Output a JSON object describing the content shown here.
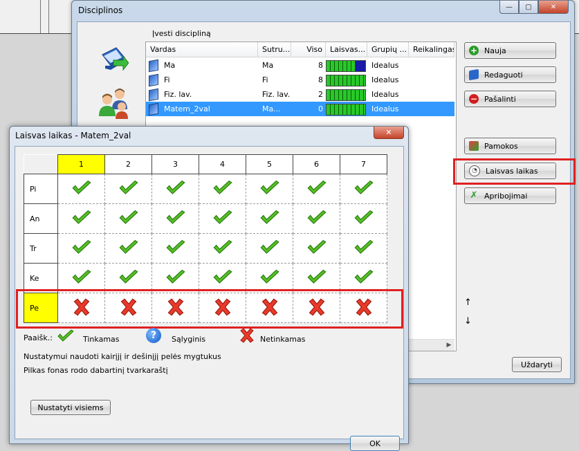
{
  "main_window": {
    "title": "Disciplinos",
    "caption_buttons": {
      "minimize": "—",
      "maximize": "▢",
      "close": "✕"
    },
    "enter_label": "Įvesti discipliną",
    "columns": [
      "Vardas",
      "Sutru...",
      "Viso",
      "Laisvas...",
      "Grupių ...",
      "Reikalingas r"
    ],
    "rows": [
      {
        "name": "Ma",
        "short": "Ma",
        "total": "8",
        "group": "Idealus",
        "selected": false,
        "blue_tail": true
      },
      {
        "name": "Fi",
        "short": "Fi",
        "total": "8",
        "group": "Idealus",
        "selected": false,
        "blue_tail": false
      },
      {
        "name": "Fiz. lav.",
        "short": "Fiz. lav.",
        "total": "2",
        "group": "Idealus",
        "selected": false,
        "blue_tail": false
      },
      {
        "name": "Matem_2val",
        "short": "Ma...",
        "total": "0",
        "group": "Idealus",
        "selected": true,
        "blue_tail": false
      }
    ],
    "buttons": {
      "new": "Nauja",
      "edit": "Redaguoti",
      "delete": "Pašalinti",
      "lessons": "Pamokos",
      "free_time": "Laisvas laikas",
      "restrictions": "Apribojimai",
      "close": "Uždaryti"
    },
    "arrows": {
      "up": "↑",
      "down": "↓"
    }
  },
  "dialog": {
    "title": "Laisvas laikas - Matem_2val",
    "close": "✕",
    "periods": [
      "1",
      "2",
      "3",
      "4",
      "5",
      "6",
      "7"
    ],
    "days": [
      {
        "label": "Pi",
        "marks": [
          "ok",
          "ok",
          "ok",
          "ok",
          "ok",
          "ok",
          "ok"
        ]
      },
      {
        "label": "An",
        "marks": [
          "ok",
          "ok",
          "ok",
          "ok",
          "ok",
          "ok",
          "ok"
        ]
      },
      {
        "label": "Tr",
        "marks": [
          "ok",
          "ok",
          "ok",
          "ok",
          "ok",
          "ok",
          "ok"
        ]
      },
      {
        "label": "Ke",
        "marks": [
          "ok",
          "ok",
          "ok",
          "ok",
          "ok",
          "ok",
          "ok"
        ]
      },
      {
        "label": "Pe",
        "marks": [
          "no",
          "no",
          "no",
          "no",
          "no",
          "no",
          "no"
        ]
      }
    ],
    "highlighted_period": "1",
    "highlighted_day": "Pe",
    "legend": {
      "prefix": "Paaišk.:",
      "ok": "Tinkamas",
      "maybe": "Sąlyginis",
      "no": "Netinkamas"
    },
    "hint1": "Nustatymui naudoti kairįjį ir dešinįjį pelės mygtukus",
    "hint2": "Pilkas fonas rodo dabartinį tvarkaraštį",
    "set_all": "Nustatyti visiems",
    "ok": "OK"
  },
  "colors": {
    "highlight_red": "#e02020",
    "selection_blue": "#3399ff",
    "yellow": "#ffff00"
  }
}
